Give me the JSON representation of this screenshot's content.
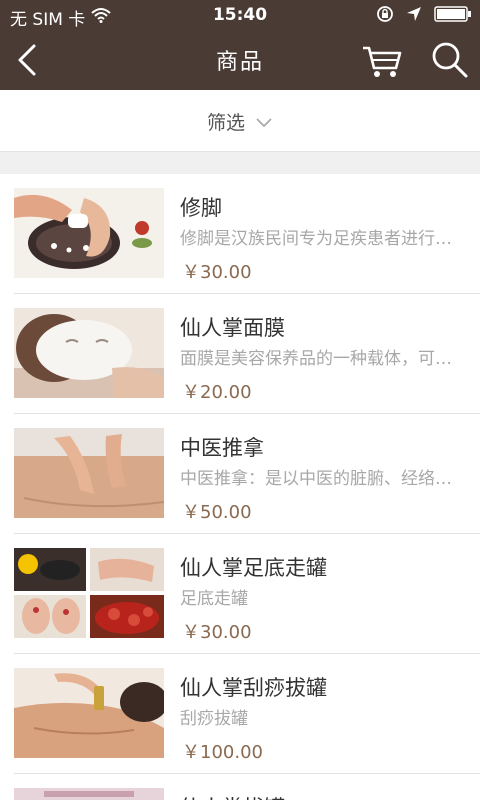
{
  "status": {
    "carrier": "无 SIM 卡",
    "time": "15:40"
  },
  "nav": {
    "title": "商品",
    "back_icon": "chevron-left-icon",
    "cart_icon": "cart-icon",
    "search_icon": "search-icon"
  },
  "filter": {
    "label": "筛选"
  },
  "colors": {
    "header_bg": "#4a3b34",
    "price": "#8a6a50",
    "desc": "#a8a8a8"
  },
  "products": [
    {
      "name": "修脚",
      "desc": "修脚是汉族民间专为足疾患者进行的一种治疗方法",
      "price": "￥30.00"
    },
    {
      "name": "仙人掌面膜",
      "desc": "面膜是美容保养品的一种载体，可以清洁皮肤",
      "price": "￥20.00"
    },
    {
      "name": "中医推拿",
      "desc": "中医推拿：是以中医的脏腑、经络学说为理论基础",
      "price": "￥50.00"
    },
    {
      "name": "仙人掌足底走罐",
      "desc": "足底走罐",
      "price": "￥30.00"
    },
    {
      "name": "仙人掌刮痧拔罐",
      "desc": "刮痧拔罐",
      "price": "￥100.00"
    },
    {
      "name": "仙人掌拔罐"
    }
  ]
}
